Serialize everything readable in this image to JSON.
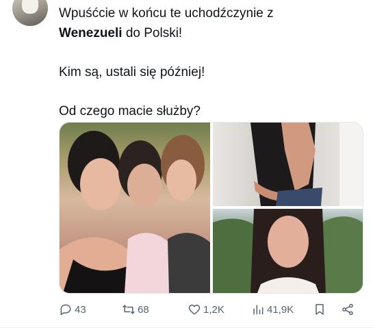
{
  "tweet": {
    "line1": "Wpuśćcie w końcu te uchodźczynie z",
    "line2_bold": "Wenezueli",
    "line2_rest": " do Polski!",
    "line3": "Kim są, ustali się później!",
    "line4": "Od czego macie służby?"
  },
  "actions": {
    "replies": "43",
    "retweets": "68",
    "likes": "1,2K",
    "views": "41,9K"
  },
  "icons": [
    "reply-icon",
    "retweet-icon",
    "heart-icon",
    "views-icon",
    "bookmark-icon",
    "share-icon"
  ]
}
